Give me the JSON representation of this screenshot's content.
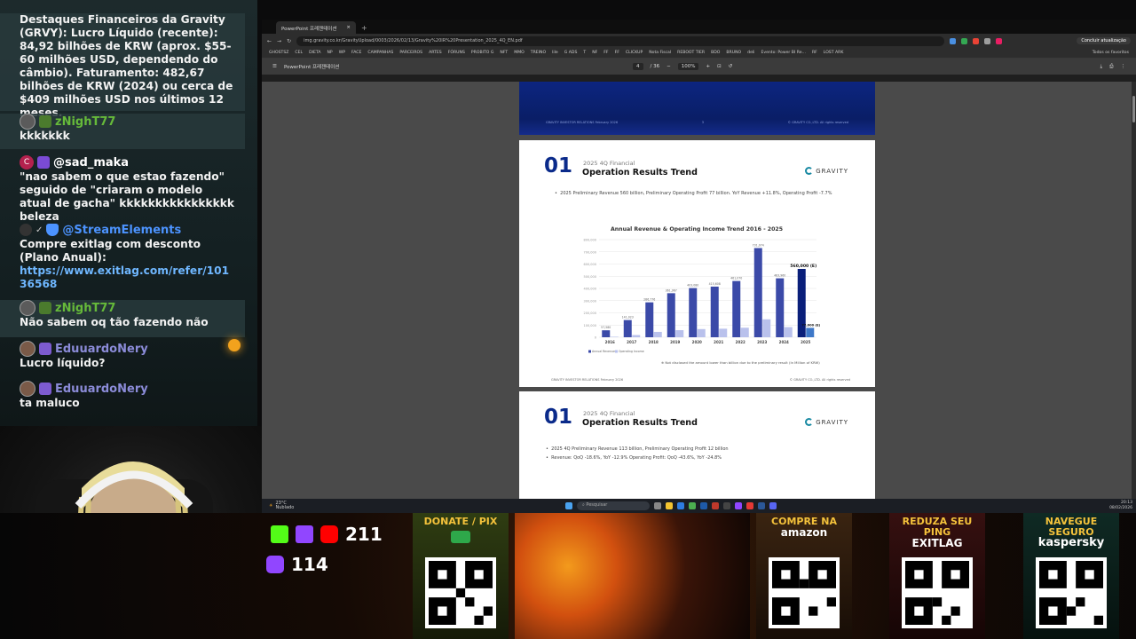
{
  "chat": {
    "messages": [
      {
        "user": "",
        "text": "Destaques Financeiros da Gravity (GRVY): Lucro Líquido (recente): 84,92 bilhões de KRW (aprox. $55-60 milhões USD, dependendo do câmbio). Faturamento: 482,67 bilhões de KRW (2024) ou cerca de $409 milhões USD nos últimos 12 meses."
      },
      {
        "user": "zNighT77",
        "text": "kkkkkkk"
      },
      {
        "user": "@sad_maka",
        "text": "\"nao sabem o que estao fazendo\" seguido de \"criaram o modelo atual de gacha\" kkkkkkkkkkkkkkkk beleza"
      },
      {
        "user": "@StreamElements",
        "text": "Compre exitlag com desconto (Plano Anual):",
        "link": "https://www.exitlag.com/refer/10136568"
      },
      {
        "user": "zNighT77",
        "text": "Não sabem oq tão fazendo não"
      },
      {
        "user": "EduuardoNery",
        "text": "Lucro líquido?"
      },
      {
        "user": "EduuardoNery",
        "text": "ta maluco"
      }
    ],
    "colors": {
      "streamelements": "#4c93ff",
      "green_user": "#66ba3a",
      "purple_user": "#8b8bd8",
      "text": "#f2f2f2"
    }
  },
  "browser": {
    "tab_title": "PowerPoint 프레젠테이션",
    "tab_close": "×",
    "new_tab": "+",
    "url": "img.gravity.co.kr/GravityUpload/0003/2026/02/13/Gravity%20IR%20Presentation_2025_4Q_EN.pdf",
    "update_button": "Concluir atualização",
    "bookmarks": [
      "GHOSTSZ",
      "CEL",
      "DIETA",
      "NP",
      "WP",
      "FACE",
      "CAMPANHAS",
      "PARCEIROS",
      "ARTES",
      "FÓRUNS",
      "PROBITO G",
      "NFT",
      "MMO",
      "TREINO",
      "lile",
      "G ADS",
      "T",
      "NF",
      "FF",
      "FF",
      "CLICKUP",
      "Nota Fiscal",
      "REBOOT TIER",
      "BDO",
      "BRUNO",
      "deli",
      "Evento: Power BI Re...",
      "RF",
      "LOST ARK"
    ],
    "bookmarks_all": "Todos os favoritos"
  },
  "pdf_toolbar": {
    "doc_title": "PowerPoint 프레젠테이션",
    "page_current": "4",
    "page_total": "/ 36",
    "zoom": "100%"
  },
  "slide_prev": {
    "footer_left": "GRAVITY INVESTOR RELATIONS  February 2026",
    "footer_page": "3",
    "footer_right": "© GRAVITY CO.,LTD. All rights reserved"
  },
  "slide_main": {
    "number": "01",
    "subtitle": "2025 4Q Financial",
    "title": "Operation Results Trend",
    "logo": "GRAVITY",
    "bullet": "2025 Preliminary Revenue 560 billion, Preliminary Operating Profit 77 billion. YoY Revenue +11.8%, Operating Profit -7.7%",
    "footnote": "※ Not disclosed the amount lower than billion due to the preliminary result  (In Million of KRW)",
    "footer_left": "GRAVITY INVESTOR RELATIONS  February 2026",
    "footer_right": "© GRAVITY CO.,LTD. All rights reserved"
  },
  "chart_data": {
    "type": "bar",
    "title": "Annual Revenue & Operating Income Trend 2016 - 2025",
    "categories": [
      "2016",
      "2017",
      "2018",
      "2019",
      "2020",
      "2021",
      "2022",
      "2023",
      "2024",
      "2025"
    ],
    "series": [
      {
        "name": "Annual Revenue",
        "values": [
          57,
          141,
          286,
          361,
          403,
          415,
          461,
          731,
          483,
          560
        ],
        "labels": [
          "57,580",
          "141,023",
          "286,776",
          "361,967",
          "403,080",
          "415,608",
          "461,070",
          "731,074",
          "483,960",
          "560,000 (E)"
        ],
        "color": "#3b4aa8",
        "last_color": "#0a1f7a"
      },
      {
        "name": "Operating Income",
        "values": [
          4,
          18,
          44,
          58,
          67,
          70,
          78,
          147,
          83,
          77
        ],
        "labels": [
          "",
          "",
          "",
          "",
          "",
          "",
          "",
          "",
          "",
          "77,000 (E)"
        ],
        "color": "#b9c1ec",
        "last_color": "#3e78c8"
      }
    ],
    "ylim": [
      0,
      800
    ],
    "yticks": [
      "800,000",
      "700,000",
      "600,000",
      "500,000",
      "400,000",
      "300,000",
      "200,000",
      "100,000",
      "0"
    ],
    "legend": "bottom-left",
    "grid": true,
    "unit": "In Million of KRW"
  },
  "slide_next": {
    "number": "01",
    "subtitle": "2025 4Q Financial",
    "title": "Operation Results Trend",
    "logo": "GRAVITY",
    "bullet1": "2025 4Q Preliminary Revenue 113 billion, Preliminary Operating Profit 12 billion",
    "bullet2": "Revenue: QoQ -18.6%, YoY -12.9%     Operating Profit: QoQ -43.6%, YoY -24.8%"
  },
  "taskbar": {
    "weather_temp": "23°C",
    "weather_desc": "Nublado",
    "search_placeholder": "Pesquisar",
    "time": "20:13",
    "date": "08/02/2026"
  },
  "overlay": {
    "twitch_count": "211",
    "youtube_count": "114",
    "cards": [
      {
        "title": "DONATE / PIX",
        "subtitle": ""
      },
      {
        "title": "COMPRE NA",
        "subtitle": "amazon"
      },
      {
        "title": "REDUZA SEU PING",
        "subtitle": "EXITLAG"
      },
      {
        "title": "NAVEGUE SEGURO",
        "subtitle": "kaspersky"
      }
    ]
  }
}
